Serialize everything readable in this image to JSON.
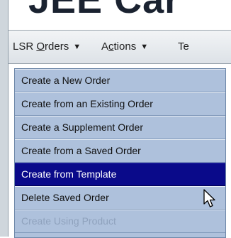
{
  "header": {
    "logo_text": "JEE Car"
  },
  "menubar": {
    "items": [
      {
        "label_prefix": "LSR ",
        "label_underlined": "O",
        "label_suffix": "rders"
      },
      {
        "label_prefix": "A",
        "label_underlined": "c",
        "label_suffix": "tions"
      },
      {
        "label": "Te"
      }
    ]
  },
  "dropdown": {
    "items": [
      {
        "label": "Create a New Order",
        "state": "normal"
      },
      {
        "label": "Create from an Existing Order",
        "state": "normal"
      },
      {
        "label": "Create a Supplement Order",
        "state": "normal"
      },
      {
        "label": "Create from a Saved Order",
        "state": "normal"
      },
      {
        "label": "Create from Template",
        "state": "selected"
      },
      {
        "label": "Delete Saved Order",
        "state": "normal"
      },
      {
        "label": "Create Using Product",
        "state": "disabled"
      }
    ]
  },
  "colors": {
    "menu_background": "#aec1dc",
    "selected_background": "#0a0a8a",
    "selected_text": "#ffffff"
  },
  "icons": {
    "dropdown_arrow": "triangle-down-icon",
    "cursor": "mouse-pointer-icon"
  }
}
